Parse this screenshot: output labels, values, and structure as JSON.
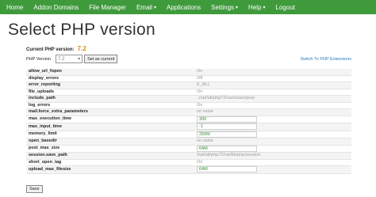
{
  "nav": {
    "items": [
      {
        "label": "Home",
        "caret": ""
      },
      {
        "label": "Addon Domains",
        "caret": ""
      },
      {
        "label": "File Manager",
        "caret": ""
      },
      {
        "label": "Email",
        "caret": "▾"
      },
      {
        "label": "Applications",
        "caret": ""
      },
      {
        "label": "Settings",
        "caret": "▾"
      },
      {
        "label": "Help",
        "caret": "▾"
      },
      {
        "label": "Logout",
        "caret": ""
      }
    ]
  },
  "page": {
    "title": "Select PHP version",
    "current_label": "Current PHP version:",
    "current_value": "7.2",
    "php_version_label": "PHP Version",
    "php_version_selected": "7.2",
    "set_button": "Set as current",
    "extensions_link": "Switch To PHP Extensions",
    "save_button": "Save"
  },
  "options": [
    {
      "name": "allow_url_fopen",
      "value": "On",
      "editable": false
    },
    {
      "name": "display_errors",
      "value": "Off",
      "editable": false
    },
    {
      "name": "error_reporting",
      "value": "E_ALL",
      "editable": false
    },
    {
      "name": "file_uploads",
      "value": "On",
      "editable": false
    },
    {
      "name": "include_path",
      "value": ".:/opt/alt/php72/usr/share/pear",
      "editable": false
    },
    {
      "name": "log_errors",
      "value": "On",
      "editable": false
    },
    {
      "name": "mail.force_extra_parameters",
      "value": "no value",
      "editable": false
    },
    {
      "name": "max_execution_time",
      "value": "300",
      "editable": true
    },
    {
      "name": "max_input_time",
      "value": "-1",
      "editable": true
    },
    {
      "name": "memory_limit",
      "value": "256M",
      "editable": true
    },
    {
      "name": "open_basedir",
      "value": "no value",
      "editable": false
    },
    {
      "name": "post_max_size",
      "value": "64M",
      "editable": true
    },
    {
      "name": "session.save_path",
      "value": "/opt/alt/php72/var/lib/php/session",
      "editable": false
    },
    {
      "name": "short_open_tag",
      "value": "On",
      "editable": false
    },
    {
      "name": "upload_max_filesize",
      "value": "64M",
      "editable": true
    }
  ],
  "colors": {
    "nav_bg": "#3f9a3c",
    "accent_version": "#e08a00",
    "link": "#2a7ab8"
  }
}
